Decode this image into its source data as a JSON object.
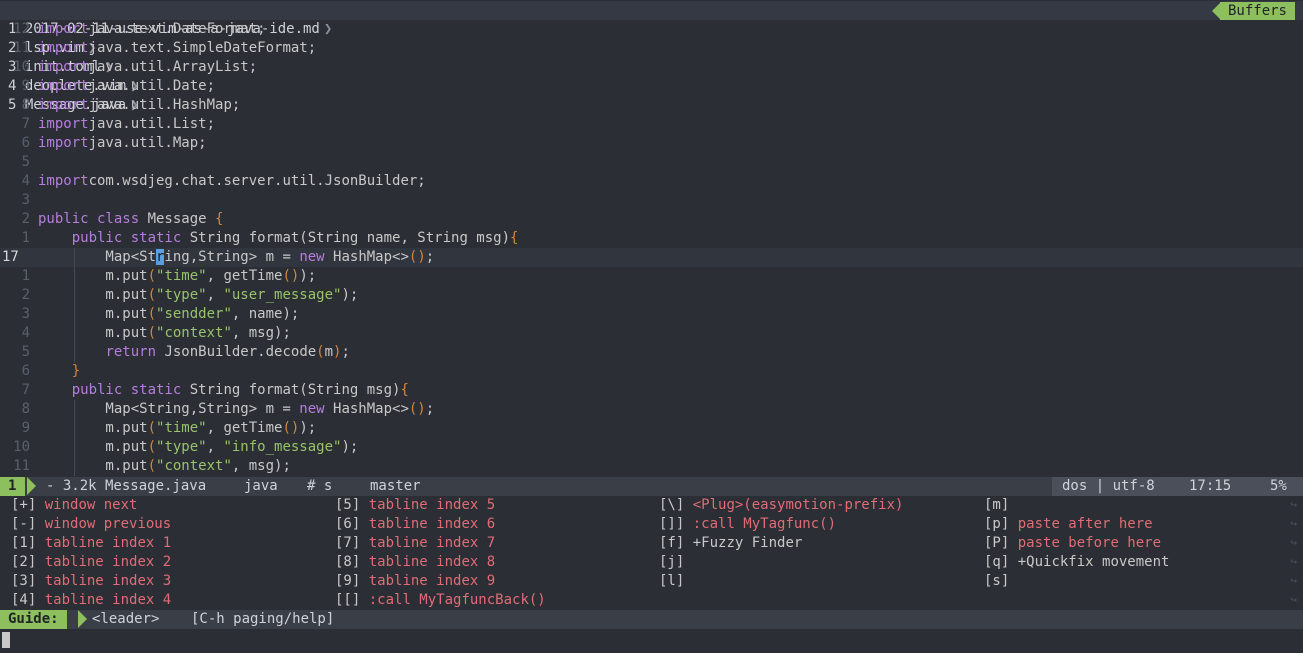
{
  "tabline": {
    "tabs": [
      "1 2017-02-11-use-vim-as-a-java-ide.md",
      "2 lsp.vim",
      "3 init.toml",
      "4 deoplete.vim",
      "5 Message.java"
    ],
    "buffers_label": "Buffers"
  },
  "code": {
    "lines": [
      {
        "n": "12",
        "segs": [
          [
            "kw",
            "import"
          ],
          [
            "",
            "java.text.DateFormat;"
          ]
        ]
      },
      {
        "n": "11",
        "segs": [
          [
            "kw",
            "import"
          ],
          [
            "",
            "java.text.SimpleDateFormat;"
          ]
        ]
      },
      {
        "n": "10",
        "segs": [
          [
            "kw",
            "import"
          ],
          [
            "",
            "java.util.ArrayList;"
          ]
        ]
      },
      {
        "n": "9",
        "segs": [
          [
            "kw",
            "import"
          ],
          [
            "",
            "java.util.Date;"
          ]
        ]
      },
      {
        "n": "8",
        "segs": [
          [
            "kw",
            "import"
          ],
          [
            "",
            "java.util.HashMap;"
          ]
        ]
      },
      {
        "n": "7",
        "segs": [
          [
            "kw",
            "import"
          ],
          [
            "",
            "java.util.List;"
          ]
        ]
      },
      {
        "n": "6",
        "segs": [
          [
            "kw",
            "import"
          ],
          [
            "",
            "java.util.Map;"
          ]
        ]
      },
      {
        "n": "5",
        "segs": []
      },
      {
        "n": "4",
        "segs": [
          [
            "kw",
            "import"
          ],
          [
            "",
            "com.wsdjeg.chat.server.util.JsonBuilder;"
          ]
        ]
      },
      {
        "n": "3",
        "segs": []
      },
      {
        "n": "2",
        "segs": [
          [
            "kw",
            "public class "
          ],
          [
            "",
            "Message "
          ],
          [
            "par",
            "{"
          ]
        ]
      },
      {
        "n": "1",
        "segs": [
          [
            "",
            "    "
          ],
          [
            "kw",
            "public static "
          ],
          [
            "",
            "String format(String name, String msg)"
          ],
          [
            "par",
            "{"
          ]
        ]
      },
      {
        "n": "17",
        "cur": true,
        "segs": [
          [
            "",
            "        Map<St"
          ],
          [
            "cursor",
            "r"
          ],
          [
            "",
            "ing,String> m = "
          ],
          [
            "kw",
            "new "
          ],
          [
            "",
            "HashMap<>"
          ],
          [
            "par",
            "()"
          ],
          [
            "",
            ";"
          ]
        ]
      },
      {
        "n": "1",
        "segs": [
          [
            "",
            "        m.put"
          ],
          [
            "par",
            "("
          ],
          [
            "str",
            "\"time\""
          ],
          [
            "",
            ", getTime"
          ],
          [
            "par",
            "()"
          ],
          [
            "",
            ");"
          ]
        ]
      },
      {
        "n": "2",
        "segs": [
          [
            "",
            "        m.put"
          ],
          [
            "par",
            "("
          ],
          [
            "str",
            "\"type\""
          ],
          [
            "",
            ", "
          ],
          [
            "str",
            "\"user_message\""
          ],
          [
            "",
            ");"
          ]
        ]
      },
      {
        "n": "3",
        "segs": [
          [
            "",
            "        m.put"
          ],
          [
            "par",
            "("
          ],
          [
            "str",
            "\"sendder\""
          ],
          [
            "",
            ", name);"
          ]
        ]
      },
      {
        "n": "4",
        "segs": [
          [
            "",
            "        m.put"
          ],
          [
            "par",
            "("
          ],
          [
            "str",
            "\"context\""
          ],
          [
            "",
            ", msg);"
          ]
        ]
      },
      {
        "n": "5",
        "segs": [
          [
            "",
            "        "
          ],
          [
            "kw",
            "return "
          ],
          [
            "",
            "JsonBuilder.decode"
          ],
          [
            "par",
            "("
          ],
          [
            "",
            "m"
          ],
          [
            "par",
            ")"
          ],
          [
            "",
            ";"
          ]
        ]
      },
      {
        "n": "6",
        "segs": [
          [
            "",
            "    "
          ],
          [
            "par",
            "}"
          ]
        ]
      },
      {
        "n": "7",
        "segs": [
          [
            "",
            "    "
          ],
          [
            "kw",
            "public static "
          ],
          [
            "",
            "String format(String msg)"
          ],
          [
            "par",
            "{"
          ]
        ]
      },
      {
        "n": "8",
        "segs": [
          [
            "",
            "        Map<String,String> m = "
          ],
          [
            "kw",
            "new "
          ],
          [
            "",
            "HashMap<>"
          ],
          [
            "par",
            "()"
          ],
          [
            "",
            ";"
          ]
        ]
      },
      {
        "n": "9",
        "segs": [
          [
            "",
            "        m.put"
          ],
          [
            "par",
            "("
          ],
          [
            "str",
            "\"time\""
          ],
          [
            "",
            ", getTime"
          ],
          [
            "par",
            "()"
          ],
          [
            "",
            ");"
          ]
        ]
      },
      {
        "n": "10",
        "segs": [
          [
            "",
            "        m.put"
          ],
          [
            "par",
            "("
          ],
          [
            "str",
            "\"type\""
          ],
          [
            "",
            ", "
          ],
          [
            "str",
            "\"info_message\""
          ],
          [
            "",
            ");"
          ]
        ]
      },
      {
        "n": "11",
        "segs": [
          [
            "",
            "        m.put"
          ],
          [
            "par",
            "("
          ],
          [
            "str",
            "\"context\""
          ],
          [
            "",
            ", msg);"
          ]
        ]
      }
    ]
  },
  "status": {
    "mode": "1",
    "file": "- 3.2k Message.java",
    "filetype": "java",
    "info": "# s",
    "branch": "master",
    "format": "dos | utf-8",
    "position": "17:15",
    "percent": "5%"
  },
  "guide": {
    "columns": [
      [
        {
          "key": "[+]",
          "desc": "window next"
        },
        {
          "key": "[-]",
          "desc": "window previous"
        },
        {
          "key": "[1]",
          "desc": "tabline index 1"
        },
        {
          "key": "[2]",
          "desc": "tabline index 2"
        },
        {
          "key": "[3]",
          "desc": "tabline index 3"
        },
        {
          "key": "[4]",
          "desc": "tabline index 4"
        }
      ],
      [
        {
          "key": "[5]",
          "desc": "tabline index 5"
        },
        {
          "key": "[6]",
          "desc": "tabline index 6"
        },
        {
          "key": "[7]",
          "desc": "tabline index 7"
        },
        {
          "key": "[8]",
          "desc": "tabline index 8"
        },
        {
          "key": "[9]",
          "desc": "tabline index 9"
        },
        {
          "key": "[[]",
          "desc": ":call MyTagfuncBack()"
        }
      ],
      [
        {
          "key": "[\\]",
          "desc": "<Plug>(easymotion-prefix)"
        },
        {
          "key": "[]]",
          "desc": ":call MyTagfunc()"
        },
        {
          "key": "[f]",
          "desc": "+Fuzzy Finder",
          "plus": true
        },
        {
          "key": "[j]",
          "desc": ""
        },
        {
          "key": "[l]",
          "desc": ""
        }
      ],
      [
        {
          "key": "[m]",
          "desc": ""
        },
        {
          "key": "[p]",
          "desc": "paste after here"
        },
        {
          "key": "[P]",
          "desc": "paste before here"
        },
        {
          "key": "[q]",
          "desc": "+Quickfix movement",
          "plus": true
        },
        {
          "key": "[s]",
          "desc": ""
        }
      ]
    ]
  },
  "guidebar": {
    "label": "Guide:",
    "leader": "<leader>",
    "help": "[C-h paging/help]"
  }
}
